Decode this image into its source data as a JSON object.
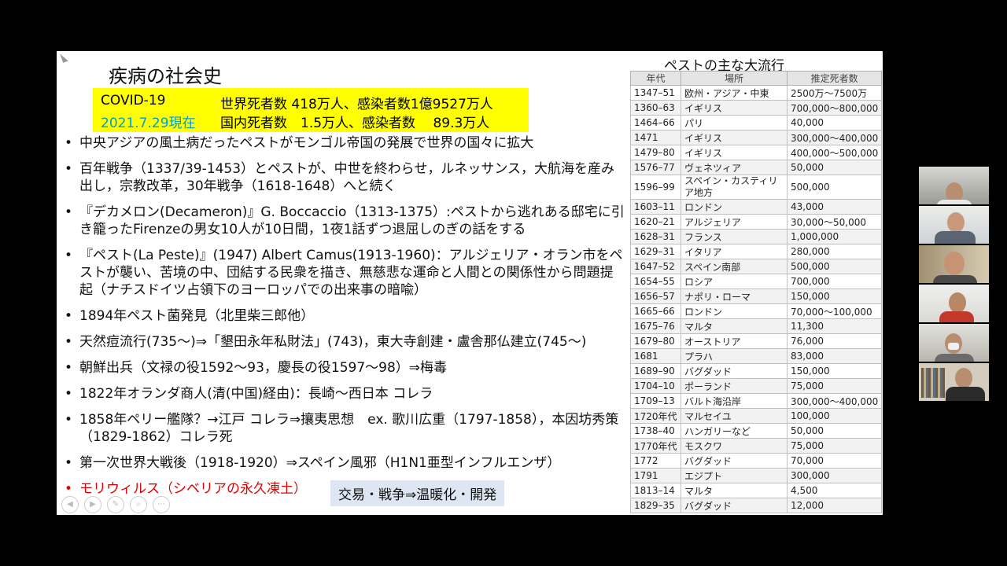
{
  "slide": {
    "title": "疾病の社会史",
    "covid": {
      "label1": "COVID-19",
      "label2": "2021.7.29現在",
      "world": "世界死者数 418万人、感染者数1億9527万人",
      "domestic": "国内死者数　1.5万人、感染者数　 89.3万人",
      "label2_color": "#00a0c8"
    },
    "bullets": [
      "中央アジアの風土病だったペストがモンゴル帝国の発展で世界の国々に拡大",
      "百年戦争（1337/39-1453）とペストが、中世を終わらせ，ルネッサンス，大航海を産み出し，宗教改革，30年戦争（1618-1648）へと続く",
      "『デカメロン(Decameron)』G. Boccaccio（1313-1375）:ペストから逃れある邸宅に引き籠ったFirenzeの男女10人が10日間，1夜1話ずつ退屈しのぎの話をする",
      "『ペスト(La Peste)』(1947) Albert Camus(1913-1960)：アルジェリア・オラン市をペストが襲い、苦境の中、団結する民衆を描き、無慈悲な運命と人間との関係性から問題提起（ナチスドイツ占領下のヨーロッパでの出来事の暗喩）",
      "1894年ペスト菌発見（北里柴三郎他）",
      "天然痘流行(735〜)⇒「墾田永年私財法」(743)，東大寺創建・盧舎那仏建立(745〜)",
      "朝鮮出兵（文禄の役1592〜93，慶長の役1597〜98）⇒梅毒",
      "1822年オランダ商人(清(中国)経由)：長崎〜西日本 コレラ",
      "1858年ペリー艦隊？→江戸 コレラ⇒攘夷思想　ex. 歌川広重（1797-1858），本因坊秀策（1829-1862）コレラ死",
      "第一次世界大戦後（1918-1920）⇒スペイン風邪（H1N1亜型インフルエンザ）",
      "モリウィルス（シベリアの永久凍土）"
    ],
    "highlight_bullet_color": "#e00000",
    "trade_box": "交易・戦争⇒温暖化・開発",
    "plague_title": "ペストの主な大流行",
    "table": {
      "headers": [
        "年代",
        "場所",
        "推定死者数"
      ],
      "rows": [
        [
          "1347–51",
          "欧州・アジア・中東",
          "2500万〜7500万"
        ],
        [
          "1360–63",
          "イギリス",
          "700,000〜800,000"
        ],
        [
          "1464–66",
          "パリ",
          "40,000"
        ],
        [
          "1471",
          "イギリス",
          "300,000〜400,000"
        ],
        [
          "1479–80",
          "イギリス",
          "400,000〜500,000"
        ],
        [
          "1576–77",
          "ヴェネツィア",
          "50,000"
        ],
        [
          "1596–99",
          "スペイン・カスティリア地方",
          "500,000"
        ],
        [
          "1603–11",
          "ロンドン",
          "43,000"
        ],
        [
          "1620–21",
          "アルジェリア",
          "30,000〜50,000"
        ],
        [
          "1628–31",
          "フランス",
          "1,000,000"
        ],
        [
          "1629–31",
          "イタリア",
          "280,000"
        ],
        [
          "1647–52",
          "スペイン南部",
          "500,000"
        ],
        [
          "1654–55",
          "ロシア",
          "700,000"
        ],
        [
          "1656–57",
          "ナポリ・ローマ",
          "150,000"
        ],
        [
          "1665–66",
          "ロンドン",
          "70,000〜100,000"
        ],
        [
          "1675–76",
          "マルタ",
          "11,300"
        ],
        [
          "1679–80",
          "オーストリア",
          "76,000"
        ],
        [
          "1681",
          "プラハ",
          "83,000"
        ],
        [
          "1689–90",
          "バグダッド",
          "150,000"
        ],
        [
          "1704–10",
          "ポーランド",
          "75,000"
        ],
        [
          "1709–13",
          "バルト海沿岸",
          "300,000〜400,000"
        ],
        [
          "1720年代",
          "マルセイユ",
          "100,000"
        ],
        [
          "1738–40",
          "ハンガリーなど",
          "50,000"
        ],
        [
          "1770年代",
          "モスクワ",
          "75,000"
        ],
        [
          "1772",
          "バグダッド",
          "70,000"
        ],
        [
          "1791",
          "エジプト",
          "300,000"
        ],
        [
          "1813–14",
          "マルタ",
          "4,500"
        ],
        [
          "1829–35",
          "バグダッド",
          "12,000"
        ]
      ]
    },
    "controls": [
      "prev-icon",
      "next-icon",
      "pen-icon",
      "zoom-icon",
      "more-icon"
    ]
  },
  "participants": [
    "participant-1",
    "participant-2",
    "participant-3",
    "participant-4",
    "participant-5",
    "participant-6"
  ]
}
